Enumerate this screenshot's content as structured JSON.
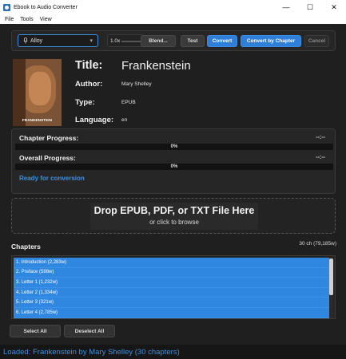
{
  "window": {
    "title": "Ebook to Audio Converter",
    "controls": [
      "—",
      "☐",
      "✕"
    ]
  },
  "menu": [
    "File",
    "Tools",
    "View"
  ],
  "toolbar": {
    "voice_icon": "microphone-icon",
    "voice_value": "Alloy",
    "voice_caret": "▾",
    "speed_value": "1.0x",
    "blend_label": "Blend...",
    "test_label": "Test",
    "convert_label": "Convert",
    "convert_by_chapter_label": "Convert by Chapter",
    "cancel_label": "Cancel"
  },
  "book": {
    "cover_title": "FRANKENSTEIN",
    "title_label": "Title:",
    "title": "Frankenstein",
    "author_label": "Author:",
    "author": "Mary Shelley",
    "type_label": "Type:",
    "type": "EPUB",
    "language_label": "Language:",
    "language": "en"
  },
  "progress": {
    "chapter_label": "Chapter Progress:",
    "chapter_time": "--:--",
    "chapter_percent": "0%",
    "chapter_fraction": 0,
    "overall_label": "Overall Progress:",
    "overall_time": "--:--",
    "overall_percent": "0%",
    "overall_fraction": 0,
    "status": "Ready for conversion"
  },
  "dropzone": {
    "title": "Drop EPUB, PDF, or TXT File Here",
    "subtitle": "or click to browse"
  },
  "chapters": {
    "header": "Chapters",
    "count": "30 ch (79,185w)",
    "items": [
      "1. Introduction (2,283w)",
      "2. Preface (588w)",
      "3. Letter 1 (1,232w)",
      "4. Letter 2 (1,334w)",
      "5. Letter 3 (321w)",
      "6. Letter 4 (2,785w)"
    ],
    "select_all_label": "Select All",
    "deselect_all_label": "Deselect All"
  },
  "statusbar": {
    "text": "Loaded: Frankenstein by Mary Shelley (30 chapters)"
  },
  "colors": {
    "accent": "#2f7fd8",
    "background": "#1f1f1f",
    "status_text": "#3d8fe0"
  }
}
